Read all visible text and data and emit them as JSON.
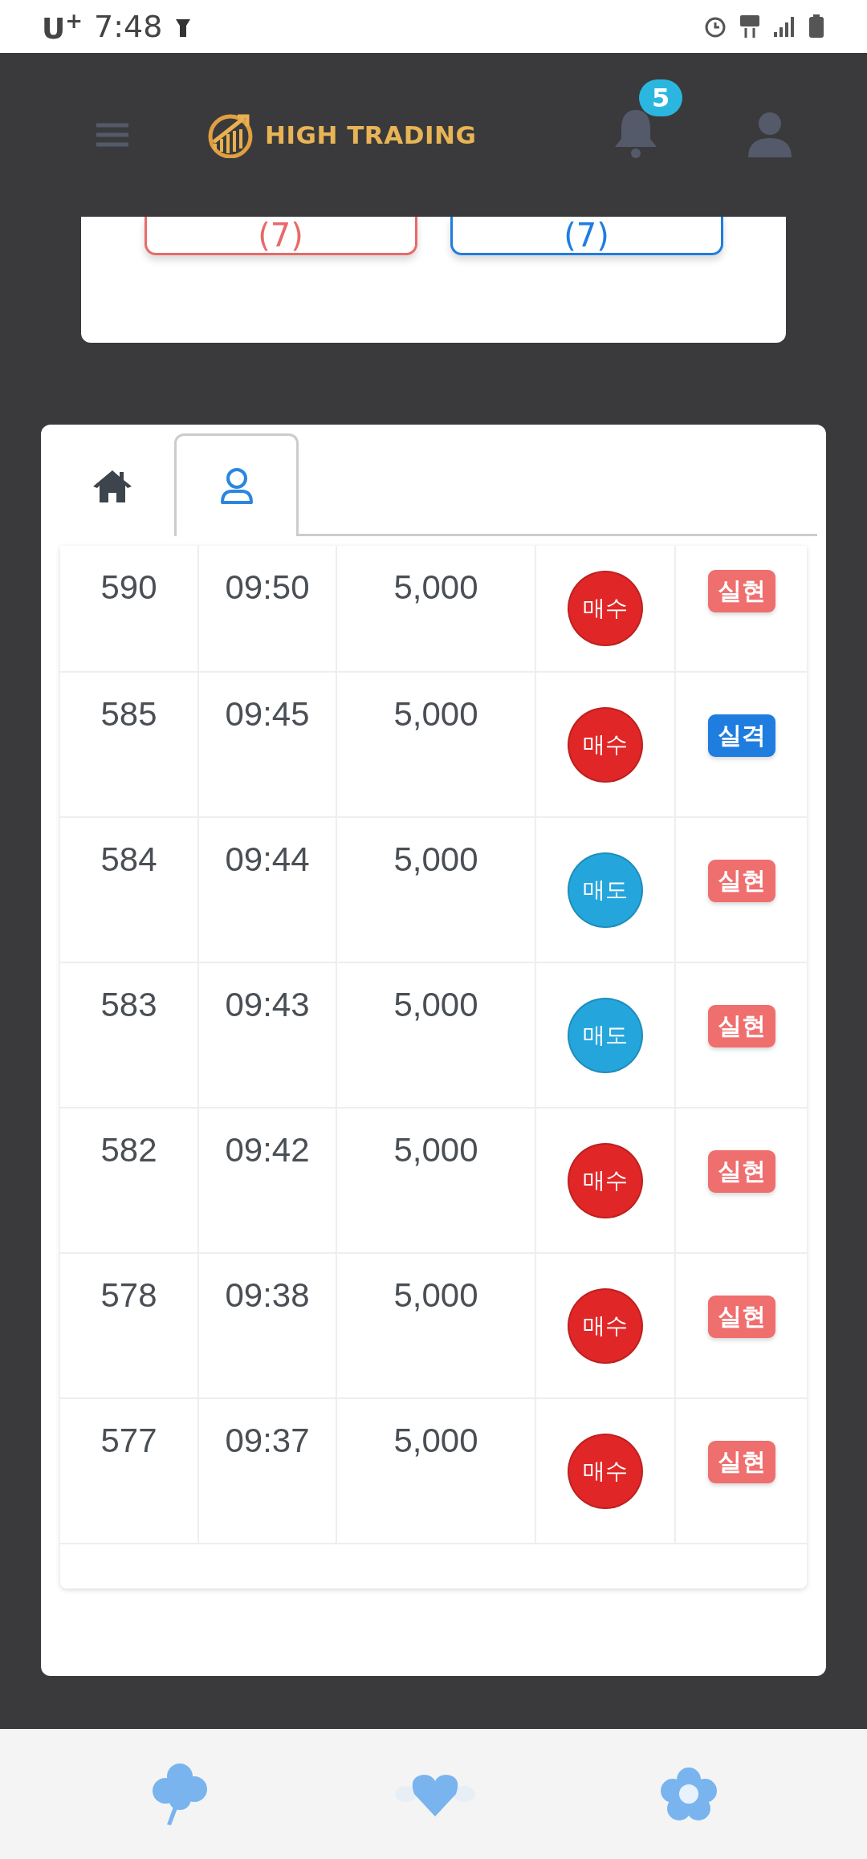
{
  "status_bar": {
    "carrier": "U$^{+}$",
    "time": "7:48"
  },
  "header": {
    "logo_text": "HIGH TRADING",
    "notification_count": "5"
  },
  "summary": {
    "buttons": [
      {
        "label": "(7)",
        "color": "#e86a6a"
      },
      {
        "label": "(7)",
        "color": "#1f7de0"
      }
    ]
  },
  "tabs": [
    {
      "kind": "home",
      "selected": false
    },
    {
      "kind": "user",
      "selected": true
    }
  ],
  "rows": [
    {
      "number": "590",
      "time": "09:50",
      "amount": "5,000",
      "side": {
        "kind": "buy",
        "label": "매수"
      },
      "result": {
        "kind": "realized",
        "label": "실현"
      }
    },
    {
      "number": "585",
      "time": "09:45",
      "amount": "5,000",
      "side": {
        "kind": "buy",
        "label": "매수"
      },
      "result": {
        "kind": "failed",
        "label": "실격"
      }
    },
    {
      "number": "584",
      "time": "09:44",
      "amount": "5,000",
      "side": {
        "kind": "sell",
        "label": "매도"
      },
      "result": {
        "kind": "realized",
        "label": "실현"
      }
    },
    {
      "number": "583",
      "time": "09:43",
      "amount": "5,000",
      "side": {
        "kind": "sell",
        "label": "매도"
      },
      "result": {
        "kind": "realized",
        "label": "실현"
      }
    },
    {
      "number": "582",
      "time": "09:42",
      "amount": "5,000",
      "side": {
        "kind": "buy",
        "label": "매수"
      },
      "result": {
        "kind": "realized",
        "label": "실현"
      }
    },
    {
      "number": "578",
      "time": "09:38",
      "amount": "5,000",
      "side": {
        "kind": "buy",
        "label": "매수"
      },
      "result": {
        "kind": "realized",
        "label": "실현"
      }
    },
    {
      "number": "577",
      "time": "09:37",
      "amount": "5,000",
      "side": {
        "kind": "buy",
        "label": "매수"
      },
      "result": {
        "kind": "realized",
        "label": "실현"
      }
    }
  ]
}
